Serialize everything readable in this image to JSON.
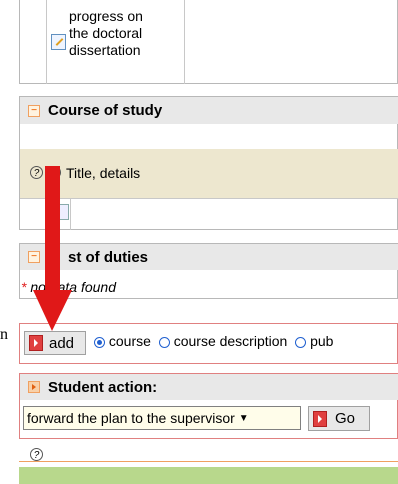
{
  "top_row": {
    "lines": [
      "progress on",
      "the doctoral",
      "dissertation"
    ]
  },
  "course_section": {
    "title": "Course of study",
    "row_label": "Title, details"
  },
  "duties_section": {
    "title": "st of duties",
    "empty_text": "no data found",
    "empty_prefix": "* n"
  },
  "edge_text": "n",
  "add_bar": {
    "add_label": "add",
    "options": [
      {
        "label": "course",
        "checked": true
      },
      {
        "label": "course description",
        "checked": false
      },
      {
        "label": "pub",
        "checked": false
      }
    ]
  },
  "student_action": {
    "title": "Student action:",
    "selected": "forward the plan to the supervisor",
    "go_label": "Go"
  },
  "colors": {
    "arrow": "#e01818",
    "beige": "#ede7cf",
    "green": "#b8d88c"
  }
}
